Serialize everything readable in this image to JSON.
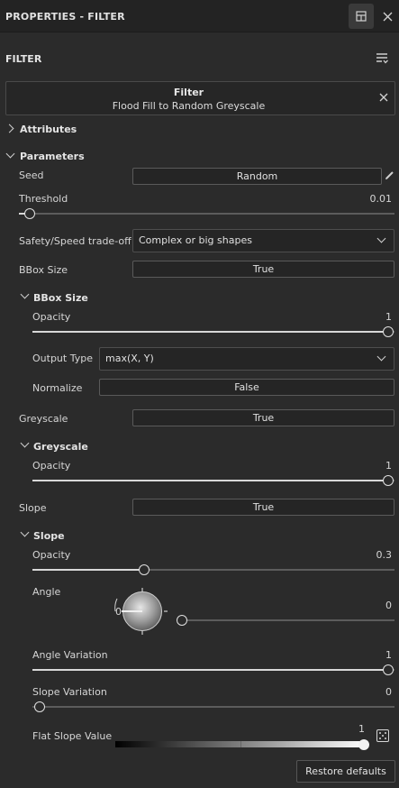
{
  "window": {
    "title": "PROPERTIES - FILTER"
  },
  "panel": {
    "header": "FILTER"
  },
  "filter": {
    "name": "Filter",
    "description": "Flood Fill to Random Greyscale"
  },
  "sections": {
    "attributes": "Attributes",
    "parameters": "Parameters",
    "bbox_size": "BBox Size",
    "greyscale": "Greyscale",
    "slope": "Slope"
  },
  "params": {
    "seed": {
      "label": "Seed",
      "value": "Random"
    },
    "threshold": {
      "label": "Threshold",
      "value": "0.01",
      "level": 0.01
    },
    "safety": {
      "label": "Safety/Speed trade-off",
      "value": "Complex or big shapes"
    },
    "bbox_size": {
      "label": "BBox Size",
      "value": "True"
    },
    "bbox_opacity": {
      "label": "Opacity",
      "value": "1",
      "level": 1
    },
    "output_type": {
      "label": "Output Type",
      "value": "max(X, Y)"
    },
    "normalize": {
      "label": "Normalize",
      "value": "False"
    },
    "greyscale": {
      "label": "Greyscale",
      "value": "True"
    },
    "greyscale_opacity": {
      "label": "Opacity",
      "value": "1",
      "level": 1
    },
    "slope": {
      "label": "Slope",
      "value": "True"
    },
    "slope_opacity": {
      "label": "Opacity",
      "value": "0.3",
      "level": 0.3
    },
    "angle": {
      "label": "Angle",
      "dial_value": "0",
      "value": "0",
      "level": 0
    },
    "angle_variation": {
      "label": "Angle Variation",
      "value": "1",
      "level": 1
    },
    "slope_variation": {
      "label": "Slope Variation",
      "value": "0",
      "level": 0
    },
    "flat_slope_value": {
      "label": "Flat Slope Value",
      "value": "1",
      "level": 1
    }
  },
  "buttons": {
    "restore_defaults": "Restore defaults"
  },
  "icons": {
    "layout": "panel-layout-icon",
    "close": "close-icon",
    "menu": "sort-menu-icon",
    "edit": "pencil-icon",
    "random": "dice-icon"
  }
}
